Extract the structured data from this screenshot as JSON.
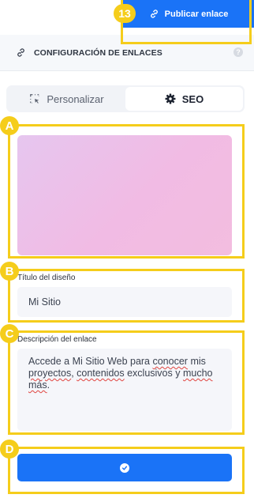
{
  "toolbar": {
    "publish_label": "Publicar enlace"
  },
  "header": {
    "title": "CONFIGURACIÓN DE ENLACES",
    "help_symbol": "?"
  },
  "tabs": [
    {
      "label": "Personalizar",
      "icon": "crop-select-icon",
      "active": false
    },
    {
      "label": "SEO",
      "icon": "gear-icon",
      "active": true
    }
  ],
  "form": {
    "title_label": "Título del diseño",
    "title_value": "Mi Sitio",
    "description_label": "Descripción del enlace",
    "description_parts": [
      "Accede a Mi Sitio Web para ",
      "conocer",
      " mis ",
      "proyectos",
      ", ",
      "contenidos",
      " exclusivos y ",
      "mucho",
      " ",
      "más",
      "."
    ]
  },
  "annotations": {
    "publish": "13",
    "preview": "A",
    "title": "B",
    "description": "C",
    "save": "D"
  },
  "colors": {
    "accent": "#1a73f7",
    "annotation": "#f5cd1b"
  }
}
